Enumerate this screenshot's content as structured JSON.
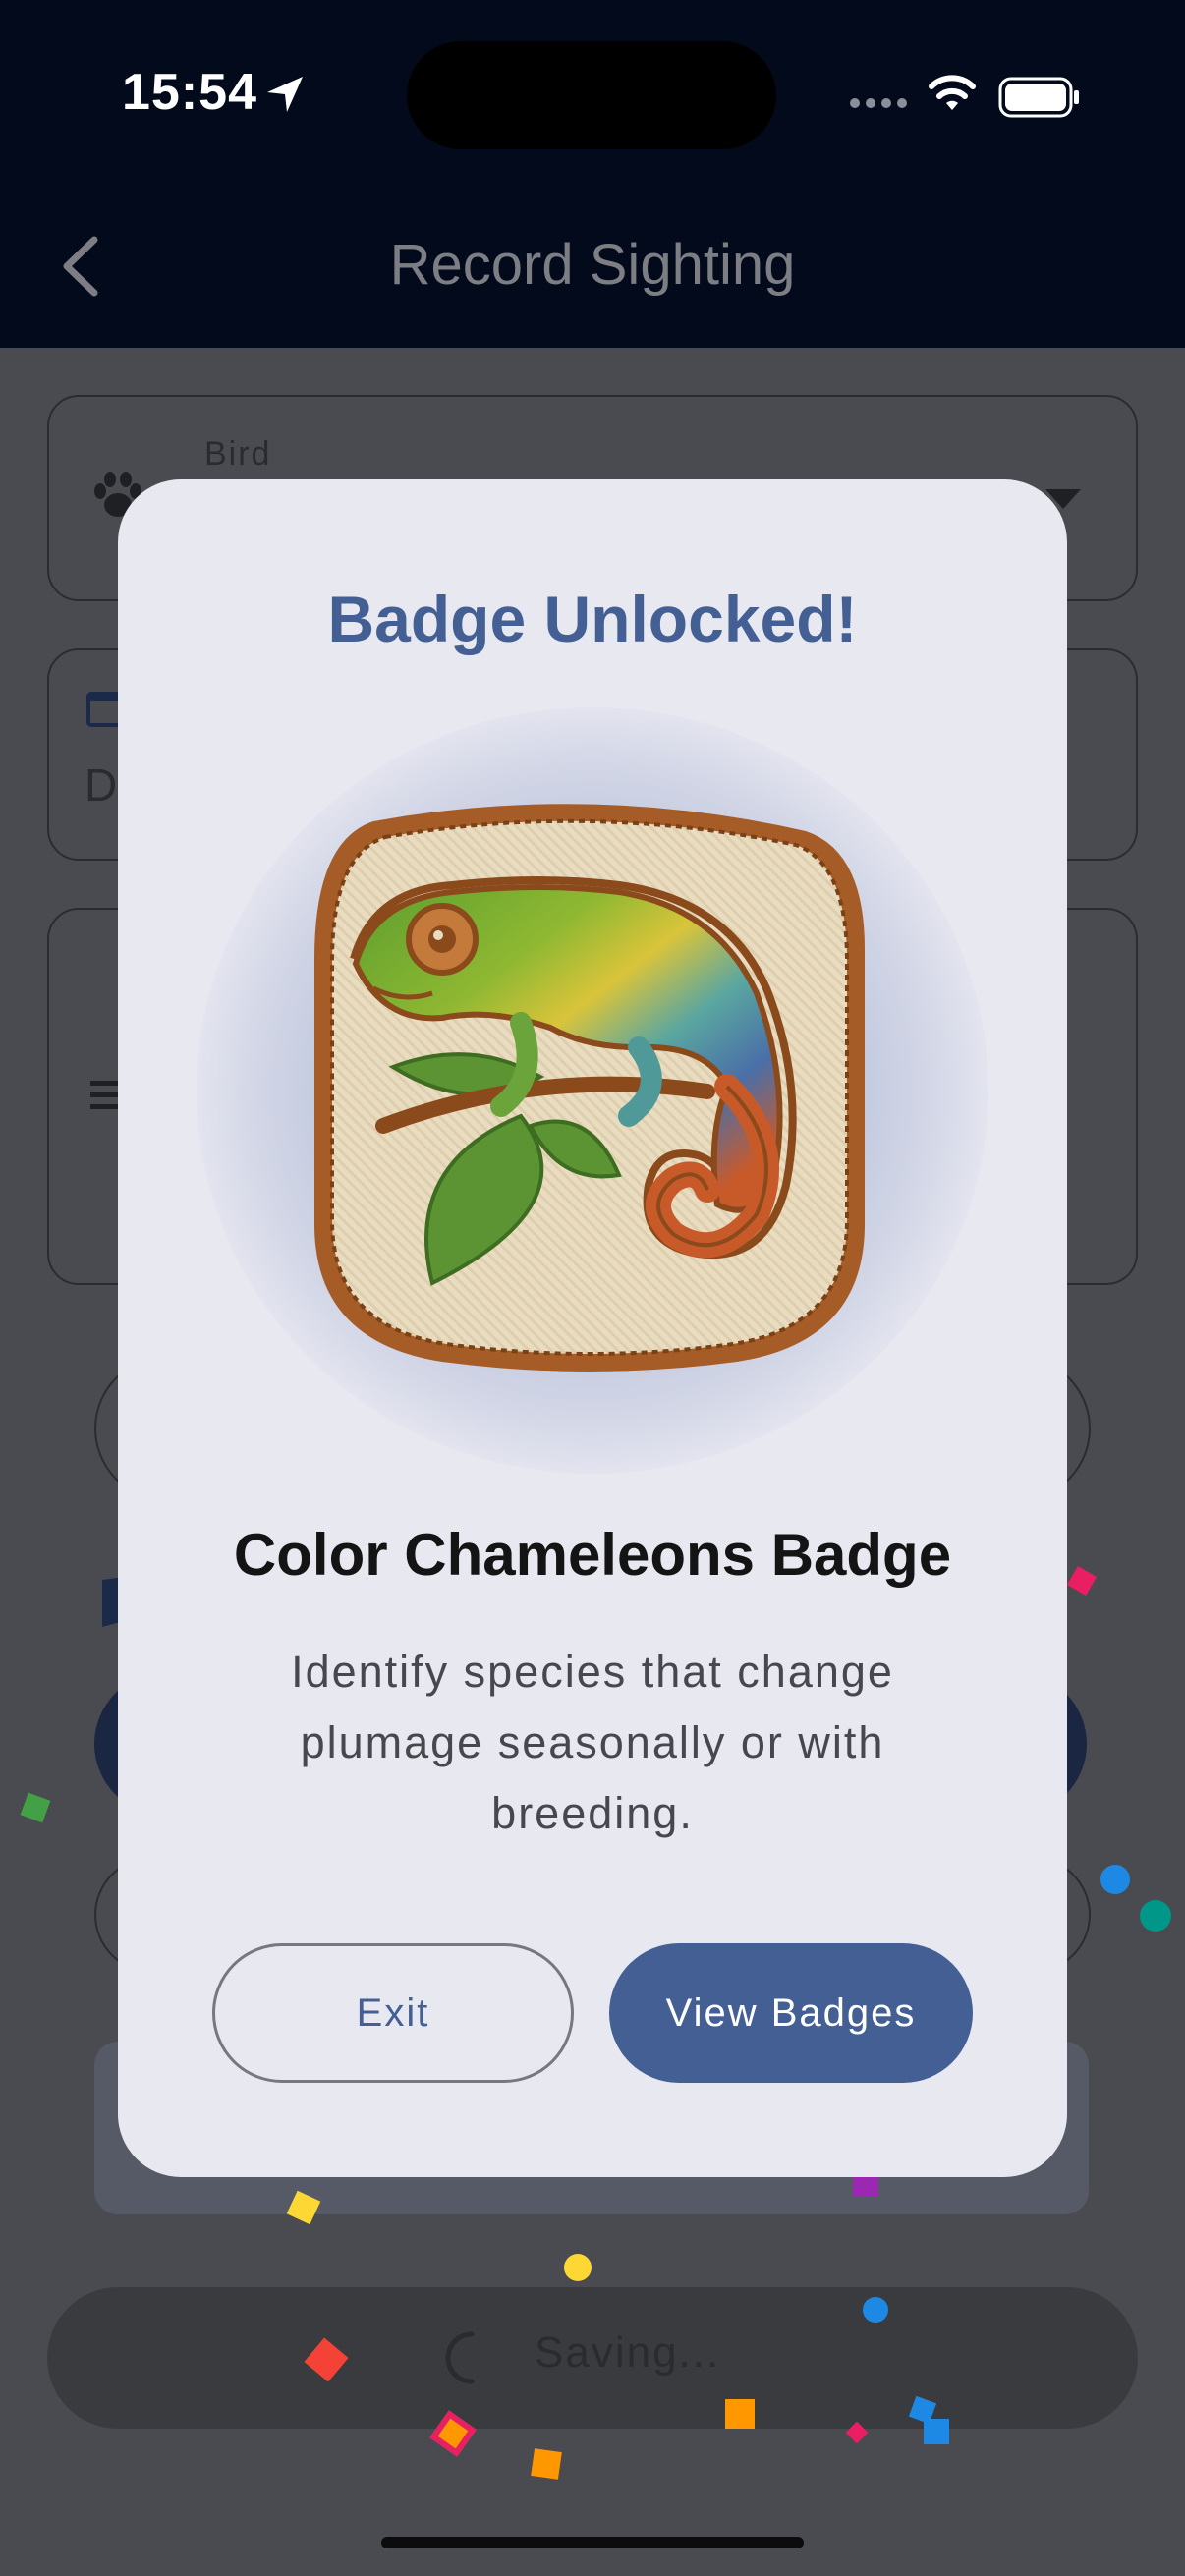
{
  "status_bar": {
    "time": "15:54",
    "icons": [
      "location-arrow-icon",
      "signal-dots-icon",
      "wifi-icon",
      "battery-icon"
    ]
  },
  "nav": {
    "title": "Record Sighting",
    "back_icon": "chevron-left-icon"
  },
  "form": {
    "bird_label": "Bird",
    "date_value_partial": "D",
    "saving_text": "Saving..."
  },
  "modal": {
    "title": "Badge Unlocked!",
    "badge_name": "Color Chameleons Badge",
    "badge_description": "Identify species that change plumage seasonally or with breeding.",
    "exit_label": "Exit",
    "view_label": "View Badges"
  },
  "colors": {
    "accent": "#445f94",
    "modal_bg": "#e8e8f1",
    "header_bg": "#020a1b",
    "dim_bg": "#4a4b50"
  }
}
